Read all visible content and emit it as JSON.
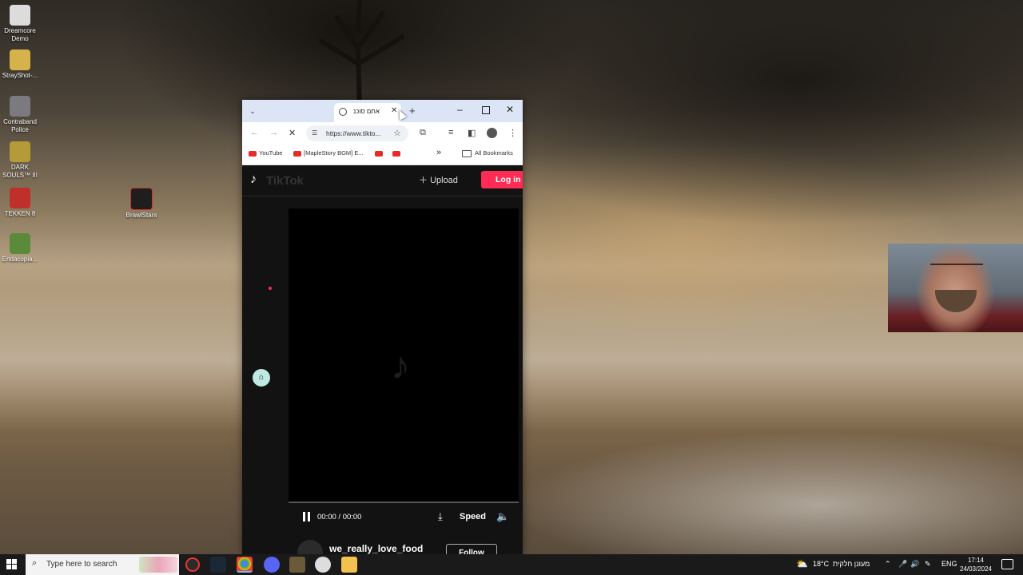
{
  "desktop": {
    "icons": [
      {
        "label": "Dreamcore Demo",
        "color": "#dcdcdc"
      },
      {
        "label": "StrayShot-...",
        "color": "#d6b24a"
      },
      {
        "label": "Contraband Police",
        "color": "#7a7a80"
      },
      {
        "label": "DARK SOULS™ III",
        "color": "#b59a3a"
      },
      {
        "label": "TEKKEN 8",
        "color": "#c0302a"
      },
      {
        "label": "Endacopia...",
        "color": "#5a8a3a"
      },
      {
        "label": "BrawlStars",
        "color": "#1e1e1e"
      }
    ]
  },
  "browser": {
    "tab_title": "אתם סוכנ",
    "url": "https://www.tikto...",
    "bookmarks": {
      "youtube": "YouTube",
      "maplestory": "[MapleStory BGM] E...",
      "overflow": "»",
      "all_bookmarks": "All Bookmarks"
    }
  },
  "tiktok": {
    "logo": "TikTok",
    "upload": "Upload",
    "login": "Log in",
    "time": "00:00 / 00:00",
    "speed": "Speed",
    "username": "we_really_love_food",
    "follow": "Follow",
    "brand_color": "#fe2c55"
  },
  "taskbar": {
    "search_placeholder": "Type here to search",
    "weather": "18°C",
    "weather_desc": "מעונן חלקית",
    "language": "ENG",
    "time": "17:14",
    "date": "24/03/2024"
  }
}
